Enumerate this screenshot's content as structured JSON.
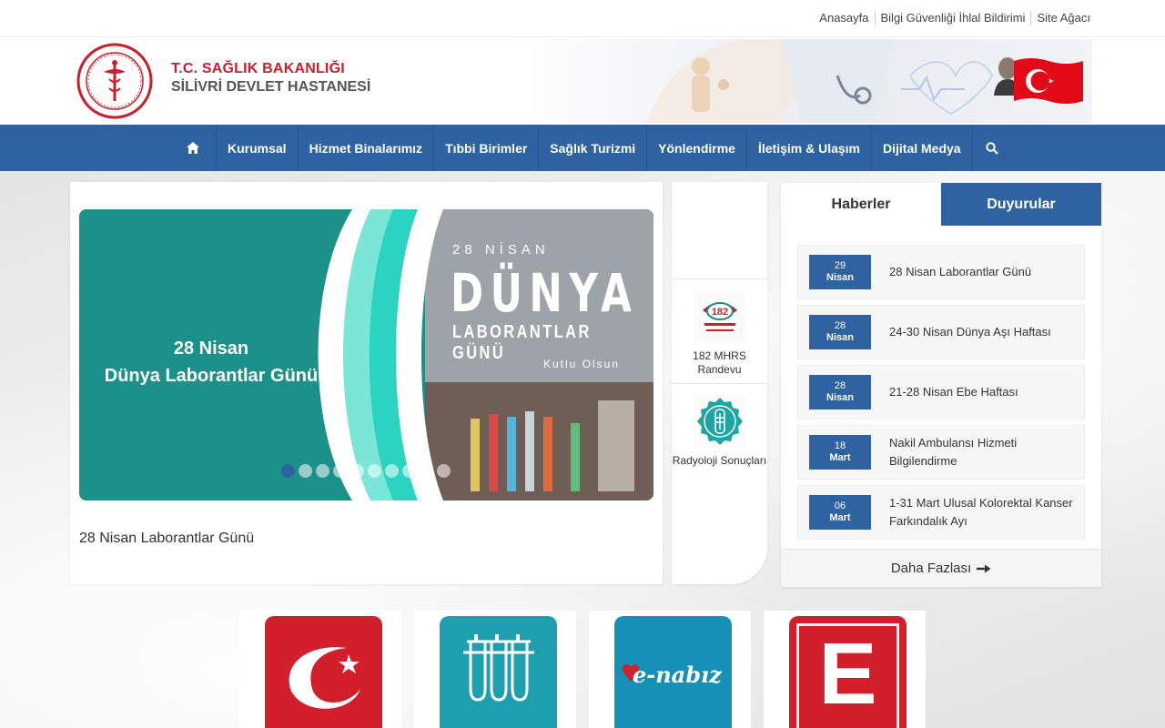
{
  "top_links": [
    "Anasayfa",
    "Bilgi Güvenliği İhlal Bildirimi",
    "Site Ağacı"
  ],
  "brand": {
    "line1": "T.C. SAĞLIK BAKANLIĞI",
    "line2": "SİLİVRİ DEVLET HASTANESİ"
  },
  "nav": {
    "items": [
      "Kurumsal",
      "Hizmet Binalarımız",
      "Tıbbi Birimler",
      "Sağlık Turizmi",
      "Yönlendirme",
      "İletişim & Ulaşım",
      "Dijital Medya"
    ]
  },
  "slider": {
    "left_title_1": "28 Nisan",
    "left_title_2": "Dünya Laborantlar Günü",
    "right_small": "28 NİSAN",
    "right_big": "DÜNYA",
    "right_mid": "LABORANTLAR GÜNÜ",
    "right_foot": "Kutlu Olsun",
    "caption": "28 Nisan Laborantlar Günü",
    "dot_count": 10,
    "active_dot": 0
  },
  "quick_links": [
    {
      "label": "182 MHRS Randevu",
      "icon": "mhrs-icon",
      "icon_text": "182"
    },
    {
      "label": "Radyoloji Sonuçları",
      "icon": "radiology-icon"
    }
  ],
  "news": {
    "tab_active": "Haberler",
    "tab_inactive": "Duyurular",
    "items": [
      {
        "day": "29",
        "month": "Nisan",
        "title": "28 Nisan Laborantlar Günü"
      },
      {
        "day": "28",
        "month": "Nisan",
        "title": "24-30 Nisan Dünya Aşı Haftası"
      },
      {
        "day": "28",
        "month": "Nisan",
        "title": "21-28 Nisan Ebe Haftası"
      },
      {
        "day": "18",
        "month": "Mart",
        "title": "Nakil Ambulansı Hizmeti Bilgilendirme"
      },
      {
        "day": "06",
        "month": "Mart",
        "title": "1-31 Mart Ulusal Kolorektal Kanser Farkındalık Ayı"
      }
    ],
    "more_label": "Daha Fazlası"
  },
  "app_tiles": [
    {
      "name": "saglik-bakanligi-app",
      "color": "#d21f2b",
      "text": ""
    },
    {
      "name": "lab-results-app",
      "color": "#1d9fb0",
      "text": ""
    },
    {
      "name": "e-nabiz-app",
      "color": "#1591b8",
      "text": "e-nabız"
    },
    {
      "name": "e-app",
      "color": "#d21f2b",
      "text": "E"
    }
  ],
  "colors": {
    "brand_blue": "#2f62a0",
    "brand_red": "#c8202b",
    "slide_teal": "#1a8f87"
  }
}
